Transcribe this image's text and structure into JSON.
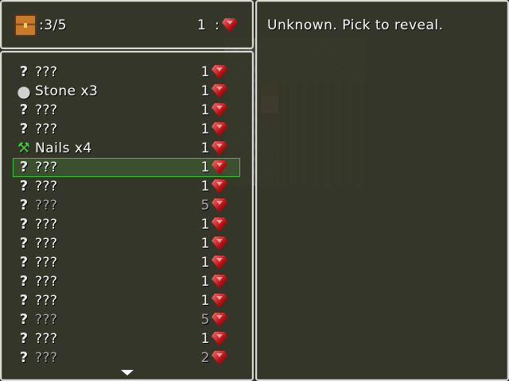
{
  "gold": {
    "count": ":3/5",
    "cost": "1",
    "separator": ":"
  },
  "help": {
    "text": "Unknown. Pick to reveal."
  },
  "items": [
    {
      "icon": "question-icon",
      "glyph": "?",
      "label": "???",
      "cost": "1",
      "dim": false
    },
    {
      "icon": "stone-icon",
      "glyph": "●",
      "label": "Stone x3",
      "cost": "1",
      "dim": false
    },
    {
      "icon": "question-icon",
      "glyph": "?",
      "label": "???",
      "cost": "1",
      "dim": false
    },
    {
      "icon": "question-icon",
      "glyph": "?",
      "label": "???",
      "cost": "1",
      "dim": false
    },
    {
      "icon": "nails-icon",
      "glyph": "⚒",
      "label": "Nails x4",
      "cost": "1",
      "dim": false
    },
    {
      "icon": "question-icon",
      "glyph": "?",
      "label": "???",
      "cost": "1",
      "dim": false,
      "selected": true
    },
    {
      "icon": "question-icon",
      "glyph": "?",
      "label": "???",
      "cost": "1",
      "dim": false
    },
    {
      "icon": "question-icon",
      "glyph": "?",
      "label": "???",
      "cost": "5",
      "dim": true
    },
    {
      "icon": "question-icon",
      "glyph": "?",
      "label": "???",
      "cost": "1",
      "dim": false
    },
    {
      "icon": "question-icon",
      "glyph": "?",
      "label": "???",
      "cost": "1",
      "dim": false
    },
    {
      "icon": "question-icon",
      "glyph": "?",
      "label": "???",
      "cost": "1",
      "dim": false
    },
    {
      "icon": "question-icon",
      "glyph": "?",
      "label": "???",
      "cost": "1",
      "dim": false
    },
    {
      "icon": "question-icon",
      "glyph": "?",
      "label": "???",
      "cost": "1",
      "dim": false
    },
    {
      "icon": "question-icon",
      "glyph": "?",
      "label": "???",
      "cost": "5",
      "dim": true
    },
    {
      "icon": "question-icon",
      "glyph": "?",
      "label": "???",
      "cost": "1",
      "dim": false
    },
    {
      "icon": "question-icon",
      "glyph": "?",
      "label": "???",
      "cost": "2",
      "dim": true
    }
  ],
  "colors": {
    "window_bg": "#343628",
    "border": "#d9d9d9",
    "selection": "#3bc23b",
    "gem": "#b00d12",
    "dim_text": "#a8a8a8"
  }
}
